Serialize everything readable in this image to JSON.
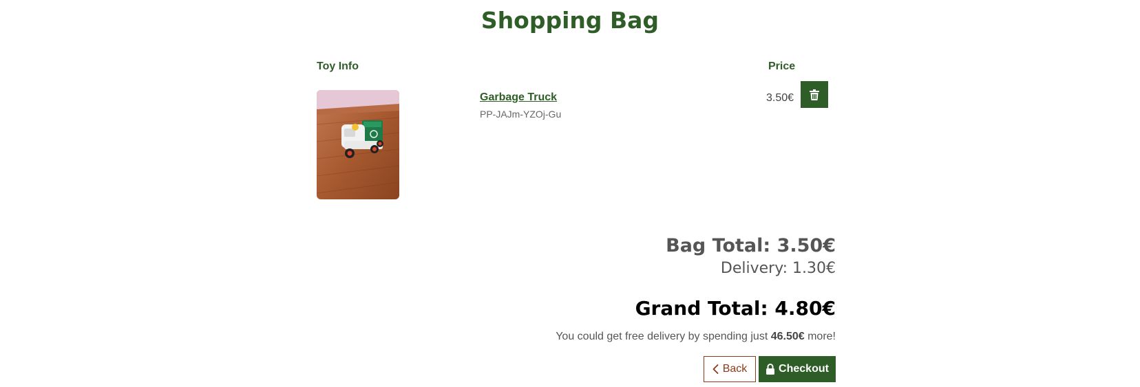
{
  "page": {
    "title": "Shopping Bag"
  },
  "table": {
    "headers": {
      "toy_info": "Toy Info",
      "price": "Price"
    },
    "items": [
      {
        "name": "Garbage Truck",
        "sku": "PP-JAJm-YZOj-Gu",
        "price": "3.50€"
      }
    ]
  },
  "summary": {
    "bag_total": "Bag Total: 3.50€",
    "delivery": "Delivery: 1.30€",
    "grand_total": "Grand Total: 4.80€",
    "free_delivery_prefix": "You could get free delivery by spending just ",
    "free_delivery_amount": "46.50€",
    "free_delivery_suffix": " more!"
  },
  "actions": {
    "back_label": "Back",
    "checkout_label": "Checkout"
  },
  "colors": {
    "brand_green": "#2f5d27",
    "back_border": "#8b3a1c"
  },
  "icons": {
    "delete": "trash-icon",
    "back": "chevron-left-icon",
    "checkout": "lock-icon"
  }
}
